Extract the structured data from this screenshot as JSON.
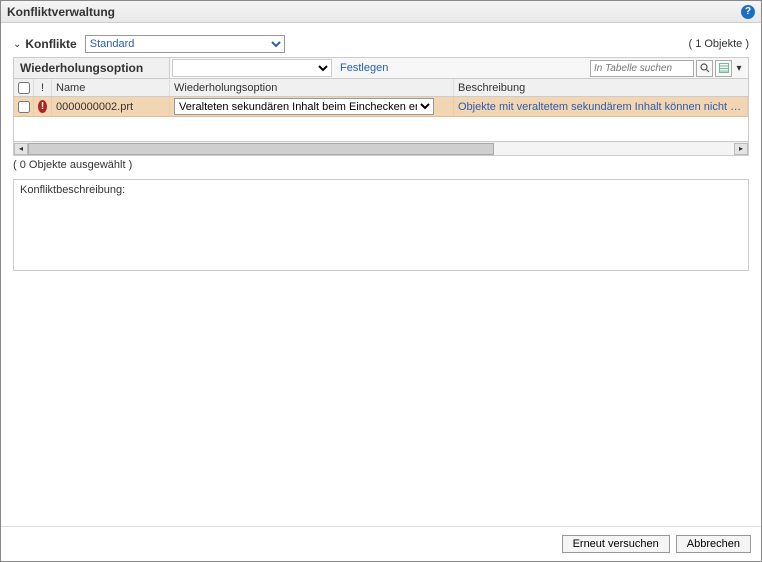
{
  "window": {
    "title": "Konfliktverwaltung"
  },
  "section": {
    "title": "Konflikte",
    "dropdown_value": "Standard",
    "count_label": "( 1 Objekte )"
  },
  "filter": {
    "label": "Wiederholungsoption",
    "dropdown_value": "",
    "set_link": "Festlegen",
    "search_placeholder": "In Tabelle suchen"
  },
  "table": {
    "headers": {
      "icon": "!",
      "name": "Name",
      "option": "Wiederholungsoption",
      "description": "Beschreibung"
    },
    "rows": [
      {
        "name": "0000000002.prt",
        "option": "Veralteten sekundären Inhalt beim Einchecken entfernen",
        "description": "Objekte mit veraltetem sekundärem Inhalt können nicht eingec"
      }
    ],
    "selection_label": "( 0 Objekte ausgewählt )"
  },
  "desc_panel": {
    "label": "Konfliktbeschreibung:"
  },
  "footer": {
    "retry": "Erneut versuchen",
    "cancel": "Abbrechen"
  }
}
